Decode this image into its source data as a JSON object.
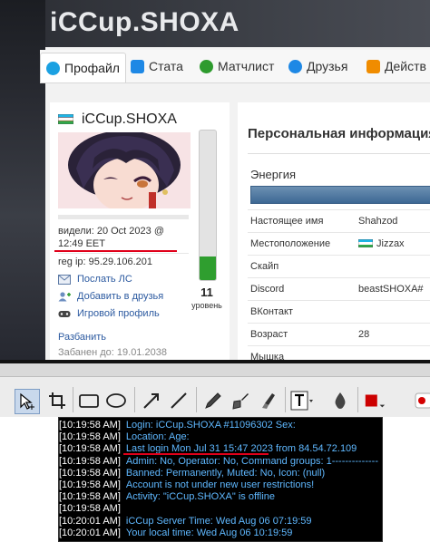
{
  "page": {
    "title": "iCCup.SHOXA",
    "tabs": [
      {
        "label": "Профайл",
        "icon": "profile-icon",
        "color": "#1ba1e2"
      },
      {
        "label": "Стата",
        "icon": "stats-icon",
        "color": "#1e88e5"
      },
      {
        "label": "Матчлист",
        "icon": "matchlist-icon",
        "color": "#2e9b2e"
      },
      {
        "label": "Друзья",
        "icon": "friends-icon",
        "color": "#1e88e5"
      },
      {
        "label": "Действ",
        "icon": "actions-icon",
        "color": "#f08c00"
      }
    ]
  },
  "profile": {
    "username": "iCCup.SHOXA",
    "seen_line1": "видели: 20 Oct 2023 @",
    "seen_line2": "12:49 EET",
    "reg_ip": "reg ip: 95.29.106.201",
    "actions": [
      "Послать ЛС",
      "Добавить в друзья",
      "Игровой профиль"
    ],
    "unban": "Разбанить",
    "banned": "Забанен до: 19.01.2038",
    "level": "11",
    "level_label": "уровень",
    "energy_fill_fraction": 0.16
  },
  "info": {
    "title": "Персональная информация",
    "energy_label": "Энергия",
    "rows": [
      {
        "key": "Настоящее имя",
        "value": "Shahzod"
      },
      {
        "key": "Местоположение",
        "value": "Jizzax"
      },
      {
        "key": "Скайп",
        "value": ""
      },
      {
        "key": "Discord",
        "value": "beastSHOXA#"
      },
      {
        "key": "ВКонтакт",
        "value": ""
      },
      {
        "key": "Возраст",
        "value": "28"
      },
      {
        "key": "Мышка",
        "value": ""
      }
    ]
  },
  "toolbar": {
    "tools": [
      "select-tool",
      "crop-tool",
      "rectangle-tool",
      "ellipse-tool",
      "arrow-tool",
      "line-tool",
      "pen-tool",
      "brush-tool",
      "highlighter-tool",
      "text-tool",
      "blur-tool",
      "color-picker",
      "record-button"
    ],
    "accent": "#cc0000"
  },
  "console": {
    "lines": [
      {
        "ts": "[10:19:58 AM]",
        "msg": "Login: iCCup.SHOXA      #11096302 Sex:",
        "color": "#5fb8ff"
      },
      {
        "ts": "[10:19:58 AM]",
        "msg": "Location:                      Age:",
        "color": "#5fb8ff"
      },
      {
        "ts": "[10:19:58 AM]",
        "msg": "Last login Mon Jul 31 15:47 2023 from 84.54.72.109",
        "color": "#5fb8ff"
      },
      {
        "ts": "[10:19:58 AM]",
        "msg": "Admin: No, Operator: No, Command groups: 1--------------",
        "color": "#5fb8ff"
      },
      {
        "ts": "[10:19:58 AM]",
        "msg": "Banned: Permanently, Muted: No, Icon: (null)",
        "color": "#5fb8ff"
      },
      {
        "ts": "[10:19:58 AM]",
        "msg": "Account is not under new user restrictions!",
        "color": "#5fb8ff"
      },
      {
        "ts": "[10:19:58 AM]",
        "msg": "Activity: \"iCCup.SHOXA\" is offline",
        "color": "#5fb8ff"
      },
      {
        "ts": "[10:19:58 AM]",
        "msg": "",
        "color": "#5fb8ff"
      },
      {
        "ts": "[10:20:01 AM]",
        "msg": "iCCup Server Time: Wed Aug 06 07:19:59",
        "color": "#5fb8ff"
      },
      {
        "ts": "[10:20:01 AM]",
        "msg": "Your local time: Wed Aug 06 10:19:59",
        "color": "#5fb8ff"
      }
    ]
  }
}
